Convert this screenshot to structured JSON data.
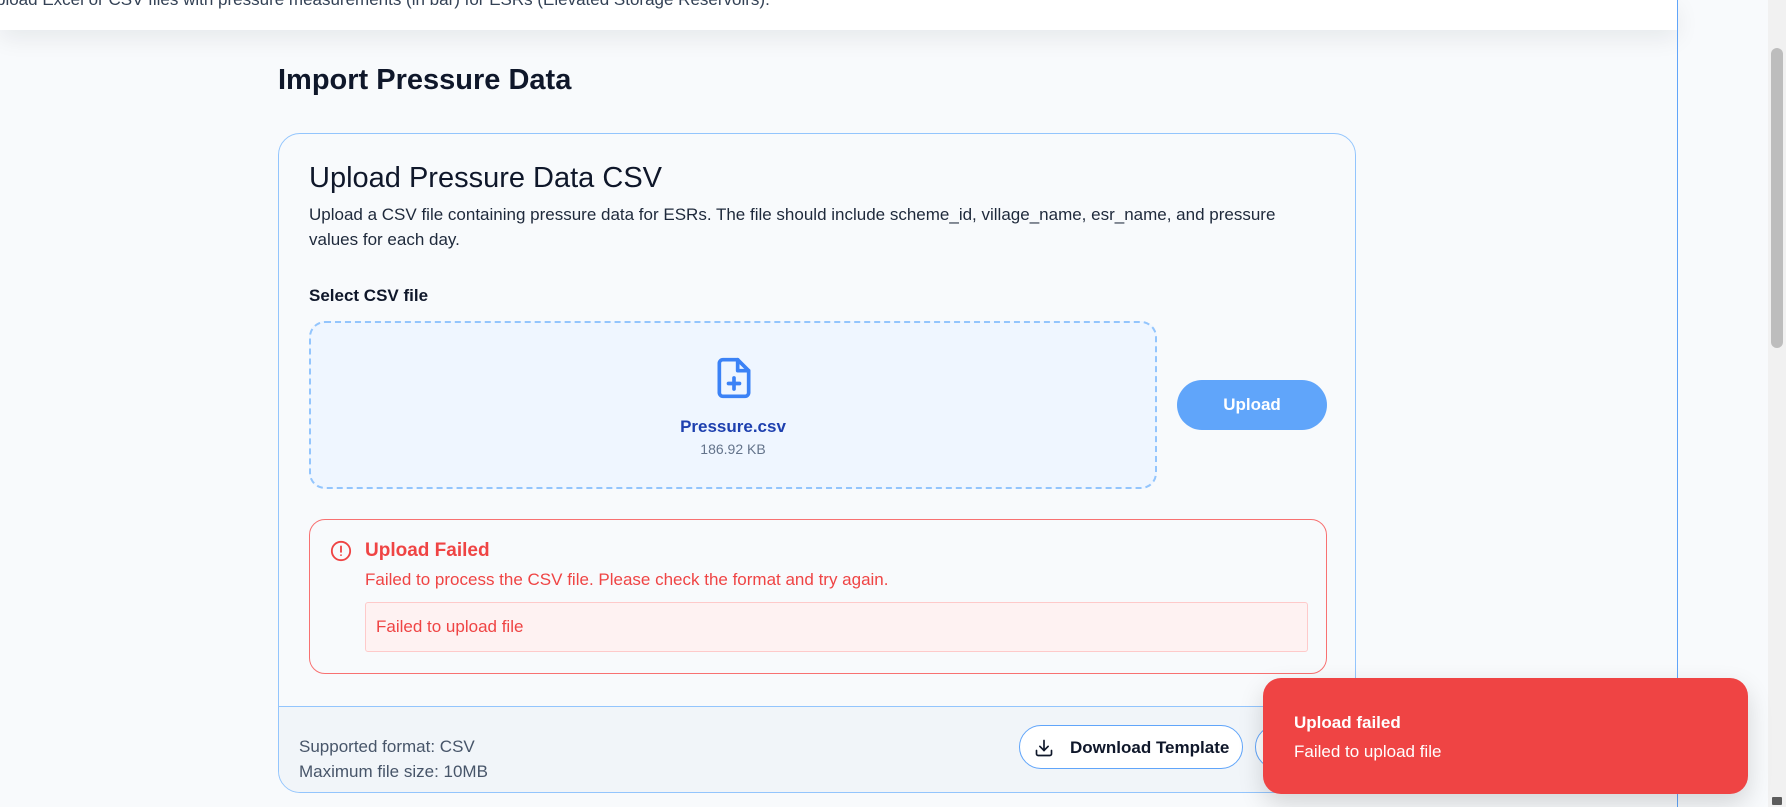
{
  "banner": {
    "text": "pload Excel or CSV files with pressure measurements (in bar) for ESRs (Elevated Storage Reservoirs)."
  },
  "page": {
    "title": "Import Pressure Data"
  },
  "card": {
    "title": "Upload Pressure Data CSV",
    "description": "Upload a CSV file containing pressure data for ESRs. The file should include scheme_id, village_name, esr_name, and pressure values for each day.",
    "field_label": "Select CSV file",
    "file": {
      "name": "Pressure.csv",
      "size": "186.92 KB",
      "icon": "file-plus-icon"
    },
    "upload_button": "Upload"
  },
  "error": {
    "icon": "alert-circle-icon",
    "title": "Upload Failed",
    "message": "Failed to process the CSV file. Please check the format and try again.",
    "detail": "Failed to upload file"
  },
  "footer": {
    "format": "Supported format: CSV",
    "max_size": "Maximum file size: 10MB",
    "download_button": "Download Template",
    "download_icon": "download-icon"
  },
  "toast": {
    "title": "Upload failed",
    "message": "Failed to upload file"
  },
  "colors": {
    "accent": "#60a5fa",
    "error": "#ef4444",
    "file_name": "#1e40af",
    "toast_bg": "#ef4444"
  }
}
